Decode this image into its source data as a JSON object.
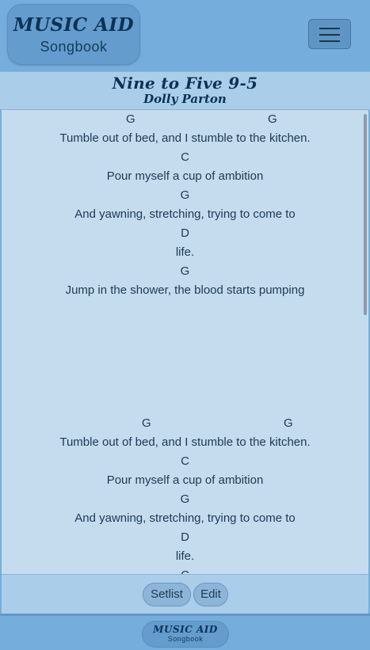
{
  "header": {
    "logo_title": "MUSIC AID",
    "logo_subtitle": "Songbook",
    "menu_icon": "hamburger-icon"
  },
  "song": {
    "title": "Nine to Five 9-5",
    "artist": "Dolly Parton"
  },
  "sheets": [
    {
      "lines": [
        {
          "type": "chords",
          "chords": [
            "G",
            "G"
          ]
        },
        {
          "type": "lyric",
          "text": "Tumble out of bed, and I stumble to the kitchen."
        },
        {
          "type": "chords",
          "chords": [
            "C"
          ]
        },
        {
          "type": "lyric",
          "text": "Pour myself a cup of ambition"
        },
        {
          "type": "chords",
          "chords": [
            "G"
          ]
        },
        {
          "type": "lyric",
          "text": "And yawning, stretching, trying to come to"
        },
        {
          "type": "chords",
          "chords": [
            "D"
          ]
        },
        {
          "type": "lyric",
          "text": "life."
        },
        {
          "type": "chords",
          "chords": [
            "G"
          ]
        },
        {
          "type": "lyric",
          "text": "Jump in the shower, the blood starts pumping"
        }
      ]
    },
    {
      "lines": [
        {
          "type": "chords",
          "chords": [
            "G",
            "G"
          ]
        },
        {
          "type": "lyric",
          "text": "Tumble out of bed, and I stumble to the kitchen."
        },
        {
          "type": "chords",
          "chords": [
            "C"
          ]
        },
        {
          "type": "lyric",
          "text": "Pour myself a cup of ambition"
        },
        {
          "type": "chords",
          "chords": [
            "G"
          ]
        },
        {
          "type": "lyric",
          "text": "And yawning, stretching, trying to come to"
        },
        {
          "type": "chords",
          "chords": [
            "D"
          ]
        },
        {
          "type": "lyric",
          "text": "life."
        },
        {
          "type": "chords",
          "chords": [
            "C"
          ]
        }
      ]
    }
  ],
  "actions": {
    "setlist_label": "Setlist",
    "edit_label": "Edit"
  },
  "footer": {
    "logo_title": "MUSIC AID",
    "logo_subtitle": "Songbook"
  },
  "colors": {
    "background": "#75aedd",
    "band": "#aacdea",
    "lyrics_bg": "#c5dcef",
    "text": "#1d3a52",
    "logo_text": "#0b3256"
  }
}
